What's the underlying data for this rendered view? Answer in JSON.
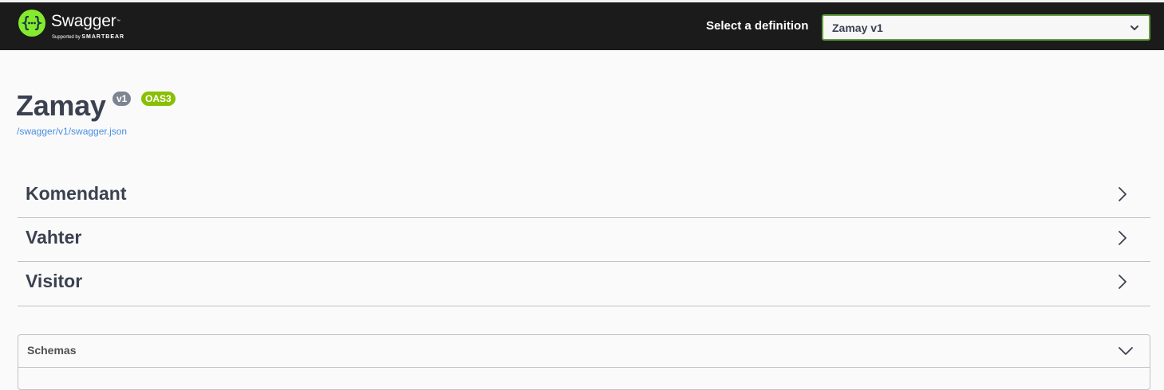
{
  "topbar": {
    "logo_name": "Swagger",
    "logo_tm": "™",
    "logo_supported": "Supported by",
    "logo_company": "SMARTBEAR",
    "definition_label": "Select a definition",
    "definition_selected": "Zamay v1",
    "accent_color": "#62a03f"
  },
  "info": {
    "title": "Zamay",
    "version_badge": "v1",
    "oas_badge": "OAS3",
    "spec_url": "/swagger/v1/swagger.json"
  },
  "tags": [
    {
      "name": "Komendant",
      "expanded": false
    },
    {
      "name": "Vahter",
      "expanded": false
    },
    {
      "name": "Visitor",
      "expanded": false
    }
  ],
  "schemas": {
    "title": "Schemas",
    "expanded": true
  },
  "icons": {
    "logo": "swagger-braces-icon",
    "select": "chevron-down-icon",
    "tag": "chevron-right-icon",
    "schemas": "chevron-down-icon"
  }
}
